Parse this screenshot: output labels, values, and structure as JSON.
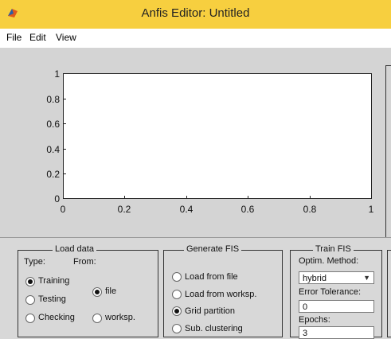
{
  "window": {
    "title": "Anfis Editor: Untitled",
    "icon": "matlab-icon"
  },
  "menu": [
    "File",
    "Edit",
    "View"
  ],
  "plot": {
    "y_ticks": [
      "0",
      "0.2",
      "0.4",
      "0.6",
      "0.8",
      "1"
    ],
    "x_ticks": [
      "0",
      "0.2",
      "0.4",
      "0.6",
      "0.8",
      "1"
    ]
  },
  "load_data": {
    "title": "Load data",
    "type_label": "Type:",
    "from_label": "From:",
    "types": [
      "Training",
      "Testing",
      "Checking"
    ],
    "sources": [
      "file",
      "worksp."
    ]
  },
  "generate_fis": {
    "title": "Generate FIS",
    "options": [
      "Load from file",
      "Load from worksp.",
      "Grid partition",
      "Sub. clustering"
    ]
  },
  "train_fis": {
    "title": "Train FIS",
    "method_label": "Optim. Method:",
    "method_value": "hybrid",
    "tolerance_label": "Error Tolerance:",
    "tolerance_value": "0",
    "epochs_label": "Epochs:",
    "epochs_value": "3"
  }
}
